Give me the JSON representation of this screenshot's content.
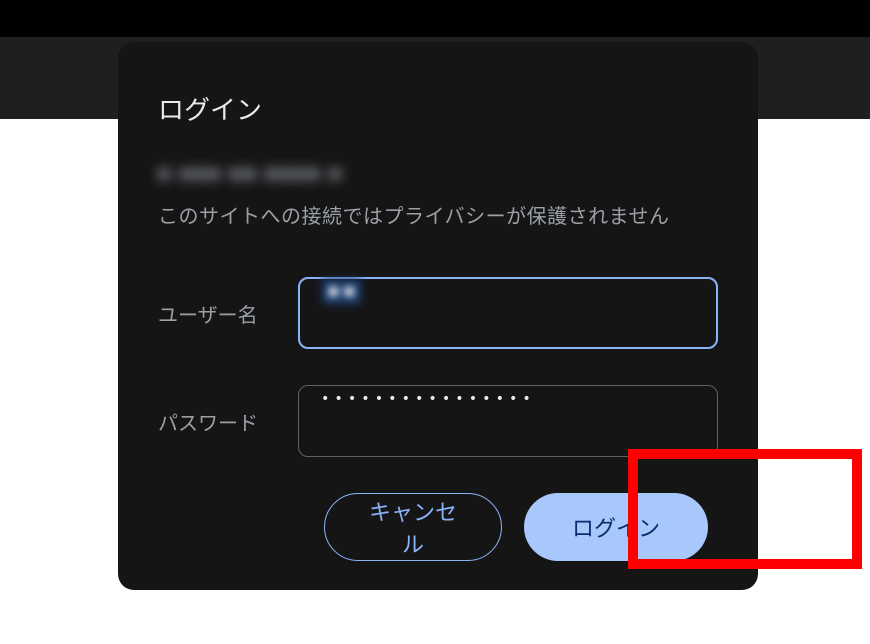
{
  "dialog": {
    "title": "ログイン",
    "site_info": "■ ■■■ ■■ ■■■■ ■",
    "privacy_warning": "このサイトへの接続ではプライバシーが保護されません",
    "username_label": "ユーザー名",
    "username_value": "■ ■",
    "password_label": "パスワード",
    "password_value": "••••••••••••••••",
    "cancel_label": "キャンセル",
    "login_label": "ログイン"
  },
  "colors": {
    "accent": "#8ab4f8",
    "button_primary_bg": "#a8c7fa",
    "button_primary_text": "#062e6f",
    "dialog_bg": "#151516",
    "text_secondary": "#9aa0a6",
    "highlight": "#ff0000"
  }
}
